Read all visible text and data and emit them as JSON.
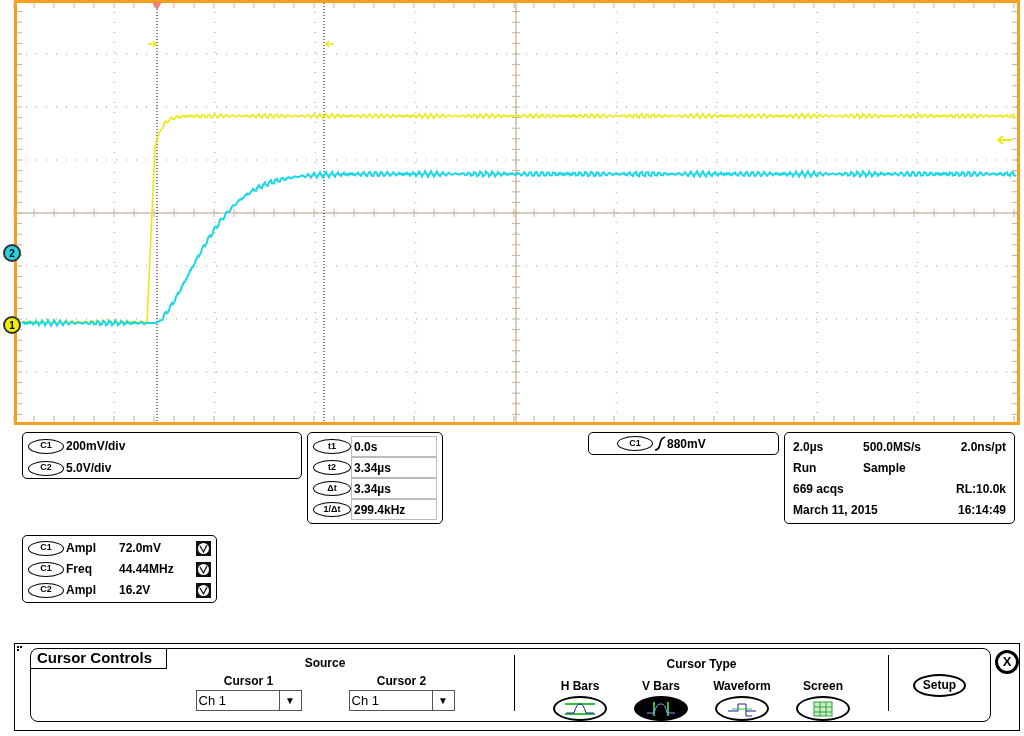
{
  "waveform_display": {
    "channel_markers": [
      {
        "label": "2",
        "color": "#22d3e0"
      },
      {
        "label": "1",
        "color": "#f0f000"
      }
    ]
  },
  "vertical_scales": [
    {
      "channel": "C1",
      "scale": "200mV/div"
    },
    {
      "channel": "C2",
      "scale": "5.0V/div"
    }
  ],
  "cursor_readouts": [
    {
      "label": "t1",
      "value": "0.0s"
    },
    {
      "label": "t2",
      "value": "3.34µs"
    },
    {
      "label": "Δt",
      "value": "3.34µs"
    },
    {
      "label": "1/Δt",
      "value": "299.4kHz"
    }
  ],
  "trigger": {
    "source": "C1",
    "level": "880mV"
  },
  "acquisition": [
    {
      "column_1": "2.0µs",
      "column_2": "500.0MS/s",
      "column_3": "2.0ns/pt"
    },
    {
      "column_1": "Run",
      "column_2": "Sample"
    },
    {
      "column_1": "669 acqs",
      "column_3": "RL:10.0k"
    },
    {
      "column_1": "March 11, 2015",
      "column_3": "16:14:49"
    }
  ],
  "measurements": [
    {
      "channel": "C1",
      "name": "Ampl",
      "value": "72.0mV"
    },
    {
      "channel": "C1",
      "name": "Freq",
      "value": "44.44MHz"
    },
    {
      "channel": "C2",
      "name": "Ampl",
      "value": "16.2V"
    }
  ],
  "cursor_controls": {
    "title": "Cursor Controls",
    "source_label": "Source",
    "sources": [
      {
        "label": "Cursor 1",
        "value": "Ch 1",
        "arrow": "▼"
      },
      {
        "label": "Cursor 2",
        "value": "Ch 1",
        "arrow": "▼"
      }
    ],
    "type_label": "Cursor Type",
    "types": [
      {
        "label": "H Bars",
        "kind": "hbars",
        "selected": false
      },
      {
        "label": "V Bars",
        "kind": "vbars",
        "selected": true
      },
      {
        "label": "Waveform",
        "kind": "waveform",
        "selected": false
      },
      {
        "label": "Screen",
        "kind": "screen",
        "selected": false
      }
    ],
    "setup": "Setup",
    "close": "X"
  }
}
